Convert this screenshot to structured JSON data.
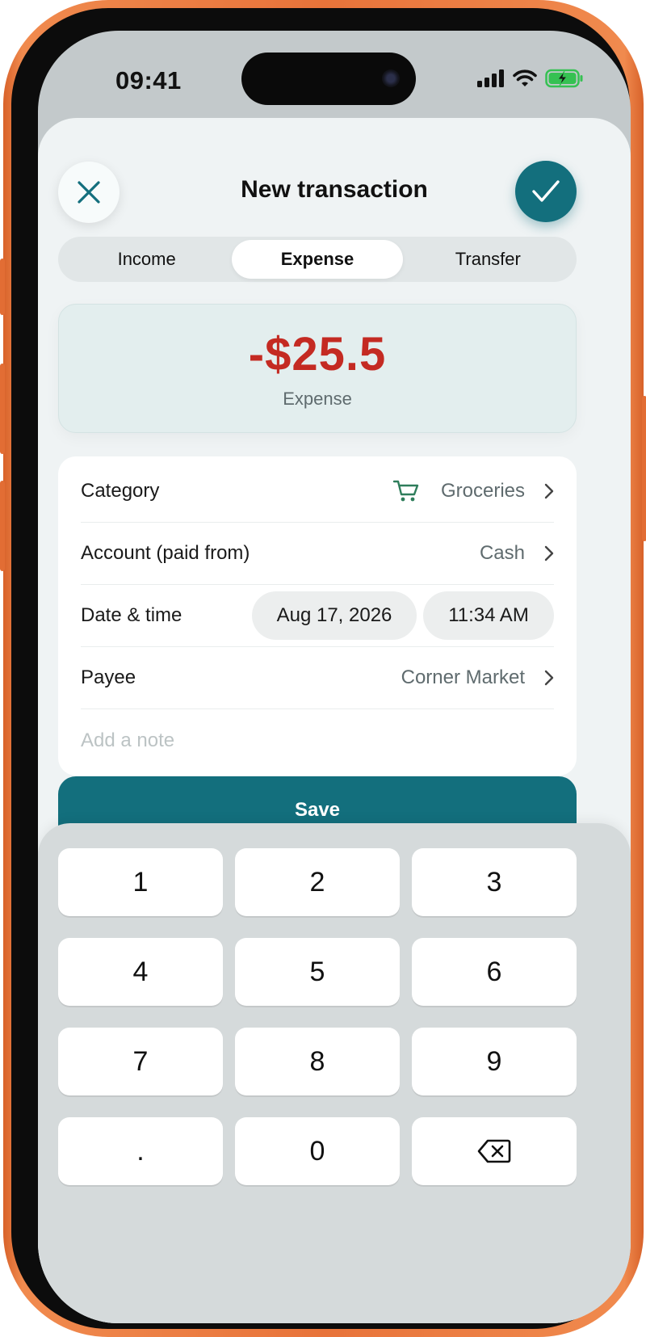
{
  "status_bar": {
    "time": "09:41"
  },
  "header": {
    "title": "New transaction",
    "close_icon": "close-icon",
    "confirm_icon": "checkmark-icon"
  },
  "type_tabs": [
    {
      "label": "Income",
      "active": false
    },
    {
      "label": "Expense",
      "active": true
    },
    {
      "label": "Transfer",
      "active": false
    }
  ],
  "amount": {
    "value": "-$25.5",
    "label": "Expense",
    "color": "#c42a22"
  },
  "form": {
    "category": {
      "label": "Category",
      "value": "Groceries",
      "icon": "cart-icon"
    },
    "account": {
      "label": "Account (paid from)",
      "value": "Cash"
    },
    "datetime": {
      "label": "Date & time",
      "date": "Aug 17, 2026",
      "time": "11:34 AM"
    },
    "payee": {
      "label": "Payee",
      "value": "Corner Market"
    },
    "note": {
      "placeholder": "Add a note"
    }
  },
  "save_label": "Save",
  "keypad": {
    "keys": [
      "1",
      "2",
      "3",
      "4",
      "5",
      "6",
      "7",
      "8",
      "9",
      ".",
      "0"
    ],
    "backspace_icon": "backspace-icon"
  },
  "colors": {
    "accent": "#136f7d",
    "expense": "#c42a22",
    "frame": "#e8733a"
  }
}
